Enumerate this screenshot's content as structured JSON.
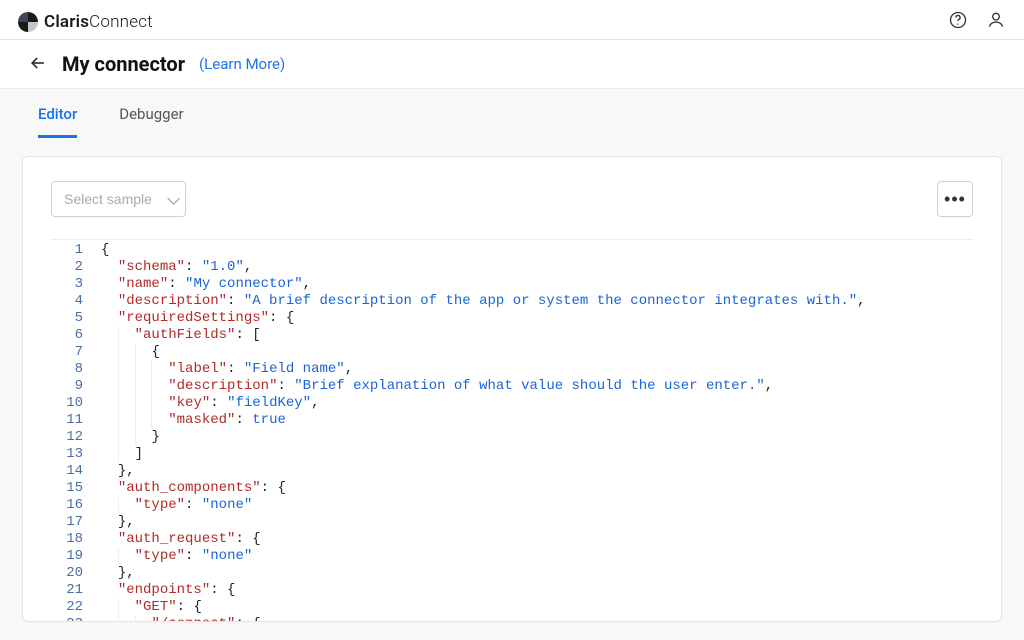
{
  "brand": {
    "part1": "Claris",
    "part2": "Connect"
  },
  "page": {
    "title": "My connector",
    "learn_more": "(Learn More)"
  },
  "tabs": [
    {
      "label": "Editor",
      "active": true
    },
    {
      "label": "Debugger",
      "active": false
    }
  ],
  "toolbar": {
    "select_placeholder": "Select sample",
    "more_label": "•••"
  },
  "editor": {
    "lines": [
      "{",
      "  \"schema\": \"1.0\",",
      "  \"name\": \"My connector\",",
      "  \"description\": \"A brief description of the app or system the connector integrates with.\",",
      "  \"requiredSettings\": {",
      "    \"authFields\": [",
      "      {",
      "        \"label\": \"Field name\",",
      "        \"description\": \"Brief explanation of what value should the user enter.\",",
      "        \"key\": \"fieldKey\",",
      "        \"masked\": true",
      "      }",
      "    ]",
      "  },",
      "  \"auth_components\": {",
      "    \"type\": \"none\"",
      "  },",
      "  \"auth_request\": {",
      "    \"type\": \"none\"",
      "  },",
      "  \"endpoints\": {",
      "    \"GET\": {",
      "      \"/connect\": {"
    ]
  }
}
